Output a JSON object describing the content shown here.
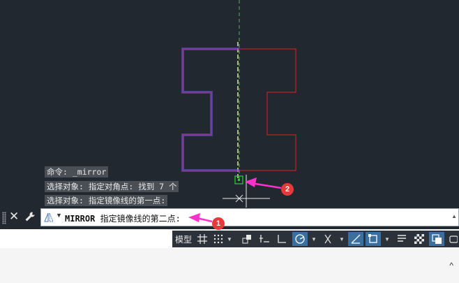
{
  "colors": {
    "canvas_bg": "#212830",
    "source_shape": "#6a5acd",
    "mirrored_shape": "#e02020",
    "mirror_line": "#d8d8a0",
    "snap_marker": "#2ecc40",
    "callout": "#e33a3a",
    "arrow": "#ff33cc"
  },
  "history": {
    "line1": "命令: _mirror",
    "line2": "选择对象: 指定对角点: 找到 7 个",
    "line3": "选择对象:  指定镜像线的第一点:"
  },
  "command_line": {
    "command": "MIRROR",
    "prompt": " 指定镜像线的第二点:",
    "close_icon": "close-icon",
    "settings_icon": "wrench-icon"
  },
  "status_bar": {
    "model_label": "模型",
    "buttons": [
      {
        "name": "grid-icon"
      },
      {
        "name": "snap-icon"
      },
      {
        "name": "infer-constraints-icon"
      },
      {
        "name": "dynamic-input-icon"
      },
      {
        "name": "ortho-icon"
      },
      {
        "name": "polar-icon"
      },
      {
        "name": "isodraft-icon"
      },
      {
        "name": "object-snap-tracking-icon"
      },
      {
        "name": "object-snap-icon"
      },
      {
        "name": "lineweight-icon"
      },
      {
        "name": "transparency-icon"
      },
      {
        "name": "selection-cycling-icon"
      }
    ]
  },
  "callouts": {
    "one": "1",
    "two": "2"
  }
}
